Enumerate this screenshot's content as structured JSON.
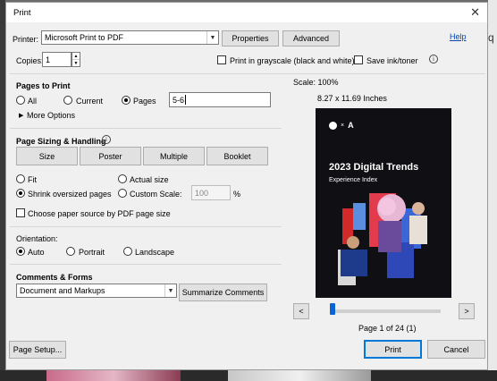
{
  "dialog": {
    "title": "Print",
    "help_link": "Help"
  },
  "printer": {
    "label": "Printer:",
    "selected": "Microsoft Print to PDF",
    "properties_button": "Properties",
    "advanced_button": "Advanced"
  },
  "copies": {
    "label": "Copies:",
    "value": "1"
  },
  "options": {
    "grayscale_label": "Print in grayscale (black and white)",
    "save_ink_label": "Save ink/toner"
  },
  "pages_to_print": {
    "heading": "Pages to Print",
    "all_label": "All",
    "current_label": "Current",
    "pages_label": "Pages",
    "pages_value": "5-6",
    "more_options": "More Options"
  },
  "sizing": {
    "heading": "Page Sizing & Handling",
    "tabs": [
      "Size",
      "Poster",
      "Multiple",
      "Booklet"
    ],
    "fit_label": "Fit",
    "actual_size_label": "Actual size",
    "shrink_label": "Shrink oversized pages",
    "custom_scale_label": "Custom Scale:",
    "custom_scale_value": "100",
    "percent": "%",
    "paper_source_label": "Choose paper source by PDF page size"
  },
  "orientation": {
    "heading": "Orientation:",
    "auto_label": "Auto",
    "portrait_label": "Portrait",
    "landscape_label": "Landscape"
  },
  "comments": {
    "heading": "Comments & Forms",
    "selected": "Document and Markups",
    "summarize_button": "Summarize Comments"
  },
  "preview": {
    "scale": "Scale: 100%",
    "page_size": "8.27 x 11.69 Inches",
    "doc_title": "2023 Digital Trends",
    "doc_subtitle": "Experience Index",
    "page_indicator": "Page 1 of 24 (1)",
    "prev_button": "<",
    "next_button": ">"
  },
  "footer": {
    "page_setup_button": "Page Setup...",
    "print_button": "Print",
    "cancel_button": "Cancel"
  }
}
